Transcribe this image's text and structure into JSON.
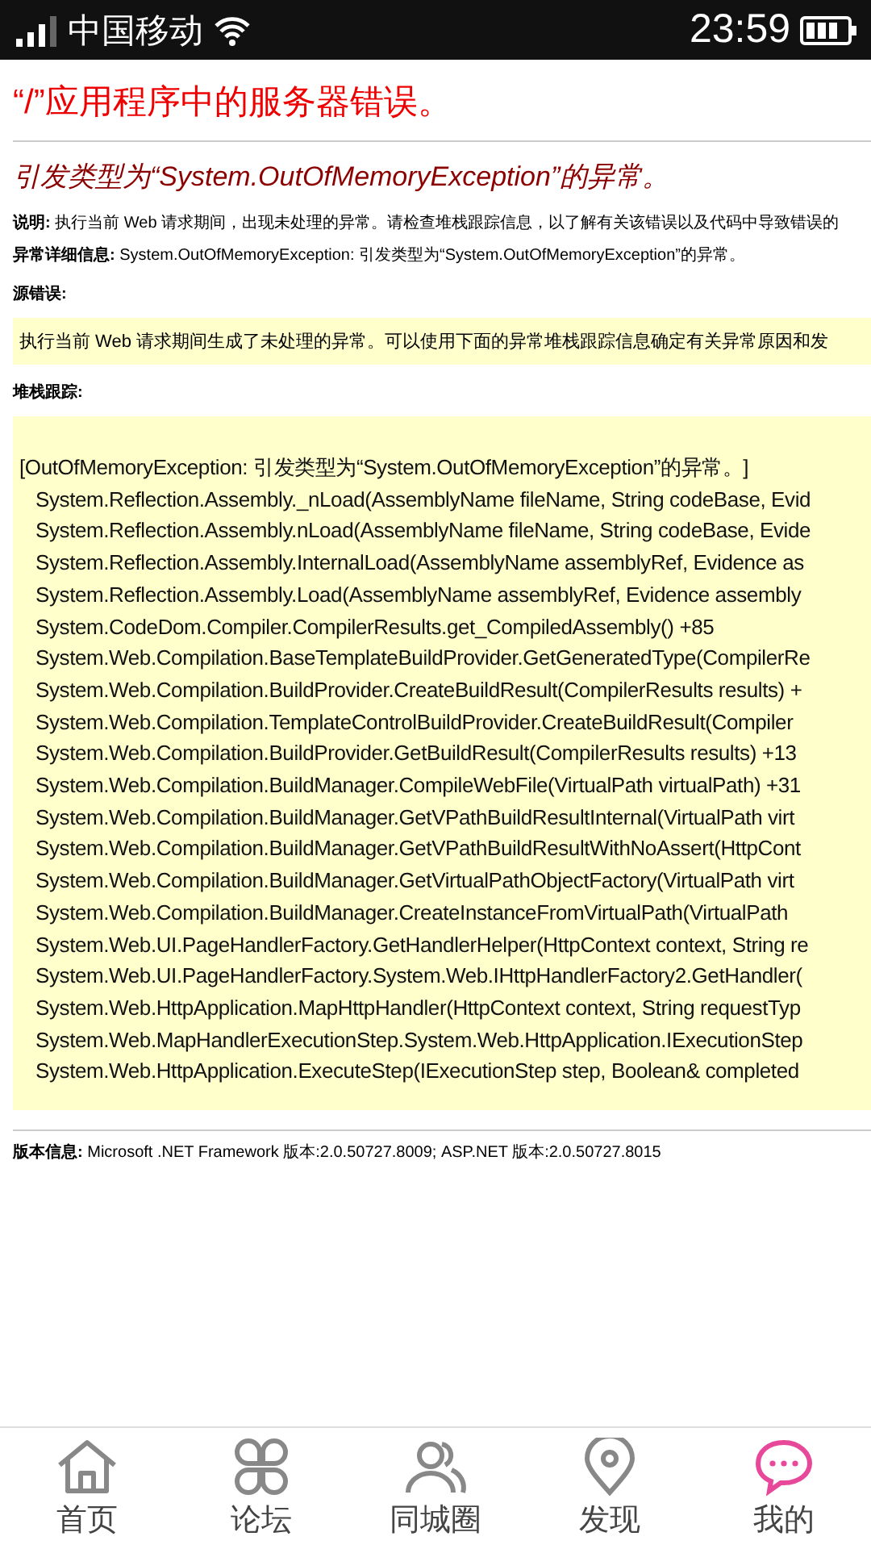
{
  "status_bar": {
    "carrier": "中国移动",
    "time": "23:59"
  },
  "page": {
    "title": "“/”应用程序中的服务器错误。",
    "subtitle": "引发类型为“System.OutOfMemoryException”的异常。",
    "description": "**说明:** 执行当前 Web 请求期间，出现未处理的异常。请检查堆栈跟踪信息，以了解有关该错误以及代码中导致错误的",
    "details": "**异常详细信息:** System.OutOfMemoryException: 引发类型为“System.OutOfMemoryException”的异常。",
    "source_label": "源错误:",
    "source_text": "执行当前  Web  请求期间生成了未处理的异常。可以使用下面的异常堆栈跟踪信息确定有关异常原因和发",
    "stack_label": "堆栈跟踪:",
    "stack_lines": [
      "[OutOfMemoryException: 引发类型为“System.OutOfMemoryException”的异常。]",
      "System.Reflection.Assembly._nLoad(AssemblyName fileName, String codeBase, Evid",
      "System.Reflection.Assembly.nLoad(AssemblyName fileName, String codeBase, Evide",
      "System.Reflection.Assembly.InternalLoad(AssemblyName assemblyRef, Evidence as",
      "System.Reflection.Assembly.Load(AssemblyName assemblyRef, Evidence assembly",
      "System.CodeDom.Compiler.CompilerResults.get_CompiledAssembly() +85",
      "System.Web.Compilation.BaseTemplateBuildProvider.GetGeneratedType(CompilerRe",
      "System.Web.Compilation.BuildProvider.CreateBuildResult(CompilerResults results) +",
      "System.Web.Compilation.TemplateControlBuildProvider.CreateBuildResult(Compiler",
      "System.Web.Compilation.BuildProvider.GetBuildResult(CompilerResults results) +13",
      "System.Web.Compilation.BuildManager.CompileWebFile(VirtualPath virtualPath) +31",
      "System.Web.Compilation.BuildManager.GetVPathBuildResultInternal(VirtualPath virt",
      "System.Web.Compilation.BuildManager.GetVPathBuildResultWithNoAssert(HttpCont",
      "System.Web.Compilation.BuildManager.GetVirtualPathObjectFactory(VirtualPath virt",
      "System.Web.Compilation.BuildManager.CreateInstanceFromVirtualPath(VirtualPath",
      "System.Web.UI.PageHandlerFactory.GetHandlerHelper(HttpContext context, String re",
      "System.Web.UI.PageHandlerFactory.System.Web.IHttpHandlerFactory2.GetHandler(",
      "System.Web.HttpApplication.MapHttpHandler(HttpContext context, String requestTyp",
      "System.Web.MapHandlerExecutionStep.System.Web.HttpApplication.IExecutionStep",
      "System.Web.HttpApplication.ExecuteStep(IExecutionStep step, Boolean& completed"
    ],
    "version": "**版本信息:** Microsoft .NET Framework 版本:2.0.50727.8009; ASP.NET 版本:2.0.50727.8015"
  },
  "tab_bar": {
    "items": [
      {
        "label": "首页",
        "kind": "home",
        "selected": false
      },
      {
        "label": "论坛",
        "kind": "forum",
        "selected": false
      },
      {
        "label": "同城圈",
        "kind": "people",
        "selected": false
      },
      {
        "label": "发现",
        "kind": "location",
        "selected": false
      },
      {
        "label": "我的",
        "kind": "chat",
        "selected": true
      }
    ]
  }
}
